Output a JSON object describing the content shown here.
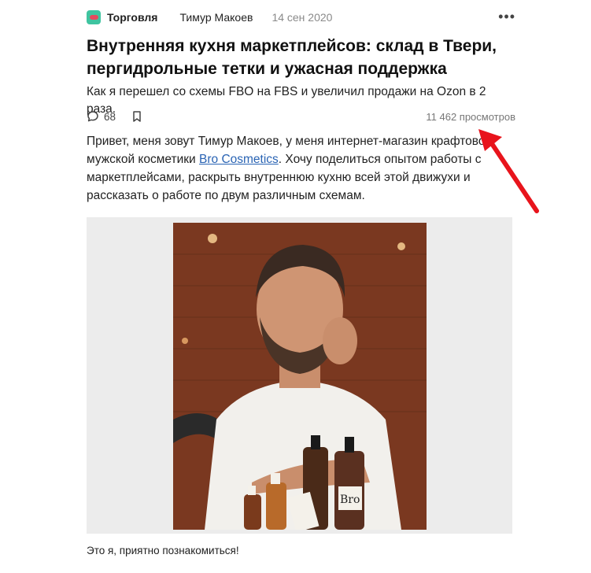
{
  "header": {
    "category": "Торговля",
    "author": "Тимур Макоев",
    "date": "14 сен 2020",
    "more_icon": "more-horizontal-icon"
  },
  "article": {
    "title": "Внутренняя кухня маркетплейсов: склад в Твери, пергидрольные тетки и ужасная поддержка",
    "subtitle": "Как я перешел со схемы FBO на FBS и увеличил продажи на Ozon в 2 раза.",
    "stats": {
      "comments_count": "68",
      "views": "11 462 просмотров"
    },
    "body": {
      "part1": "Привет, меня зовут Тимур Макоев, у меня интернет-магазин крафтовой мужской косметики ",
      "link": "Bro Cosmetics",
      "part2": ". Хочу поделиться опытом работы с маркетплейсами, раскрыть внутреннюю кухню всей этой движухи и рассказать о работе по двум различным схемам."
    },
    "image_caption": "Это я, приятно познакомиться!",
    "bottle_label": "Bro"
  },
  "colors": {
    "category_icon_bg": "#3fc4a0",
    "category_icon_fg": "#e64a5e",
    "link": "#2a64b4",
    "arrow": "#e8141c"
  }
}
